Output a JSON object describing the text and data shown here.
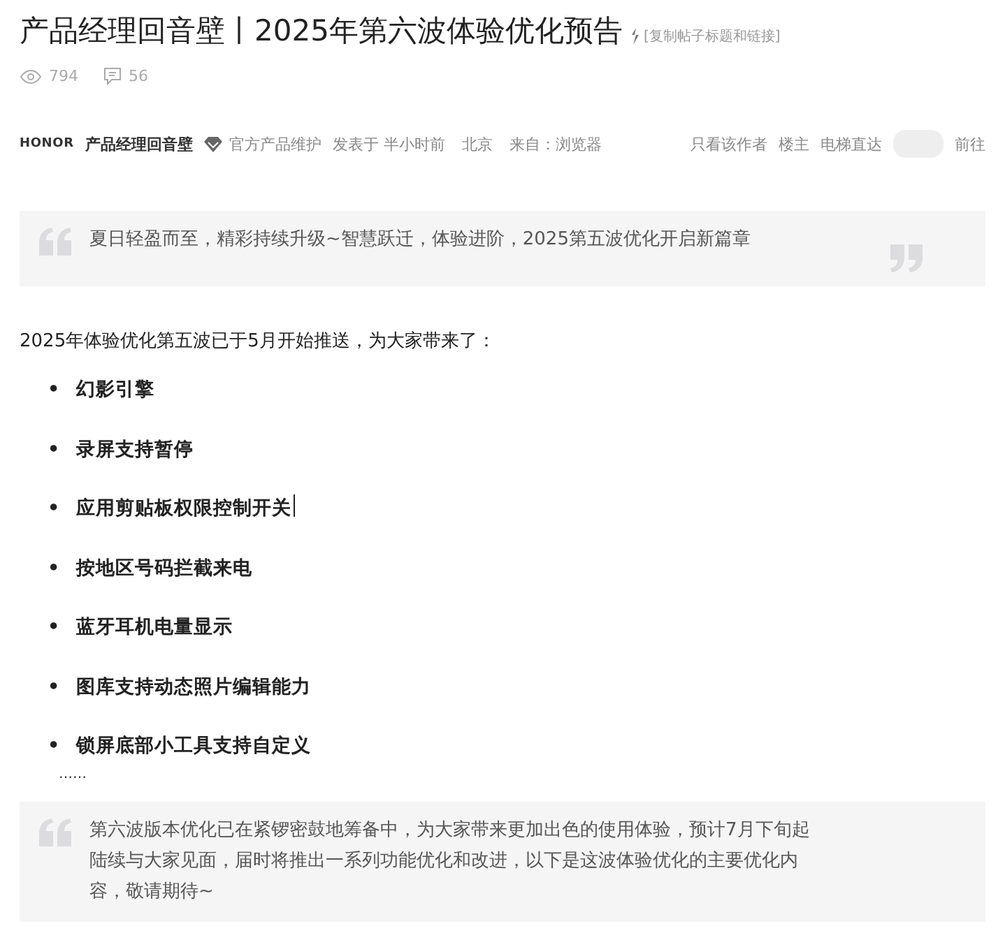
{
  "post": {
    "title": "产品经理回音壁丨2025年第六波体验优化预告",
    "copy_link": "[复制帖子标题和链接]",
    "views": "794",
    "comments": "56"
  },
  "author_bar": {
    "brand": "HONOR",
    "author": "产品经理回音壁",
    "badge": "官方产品维护",
    "posted": "发表于 半小时前",
    "location": "北京",
    "source": "来自：浏览器",
    "only_author": "只看该作者",
    "floor": "楼主",
    "jump_label": "电梯直达",
    "jump_button": "前往"
  },
  "content": [
    {
      "kind": "quote",
      "text": "夏日轻盈而至，精彩持续升级~智慧跃迁，体验进阶，2025第五波优化开启新篇章",
      "closing": true
    },
    {
      "kind": "paragraph",
      "text": "2025年体验优化第五波已于5月开始推送，为大家带来了："
    },
    {
      "kind": "list",
      "items": [
        {
          "bullet": "•",
          "text": "幻影引擎",
          "cursor": false
        },
        {
          "bullet": "•",
          "text": "录屏支持暂停",
          "cursor": false
        },
        {
          "bullet": "•",
          "text": "应用剪贴板权限控制开关",
          "cursor": true
        },
        {
          "bullet": "•",
          "text": "按地区号码拦截来电",
          "cursor": false
        },
        {
          "bullet": "•",
          "text": "蓝牙耳机电量显示",
          "cursor": false
        },
        {
          "bullet": "•",
          "text": "图库支持动态照片编辑能力",
          "cursor": false
        },
        {
          "bullet": "•",
          "text": "锁屏底部小工具支持自定义",
          "cursor": false
        }
      ]
    },
    {
      "kind": "ellipsis",
      "text": "……"
    },
    {
      "kind": "quote",
      "text": "第六波版本优化已在紧锣密鼓地筹备中，为大家带来更加出色的使用体验，预计7月下旬起陆续与大家见面，届时将推出一系列功能优化和改进，以下是这波体验优化的主要优化内容，敬请期待~",
      "closing": false
    }
  ]
}
